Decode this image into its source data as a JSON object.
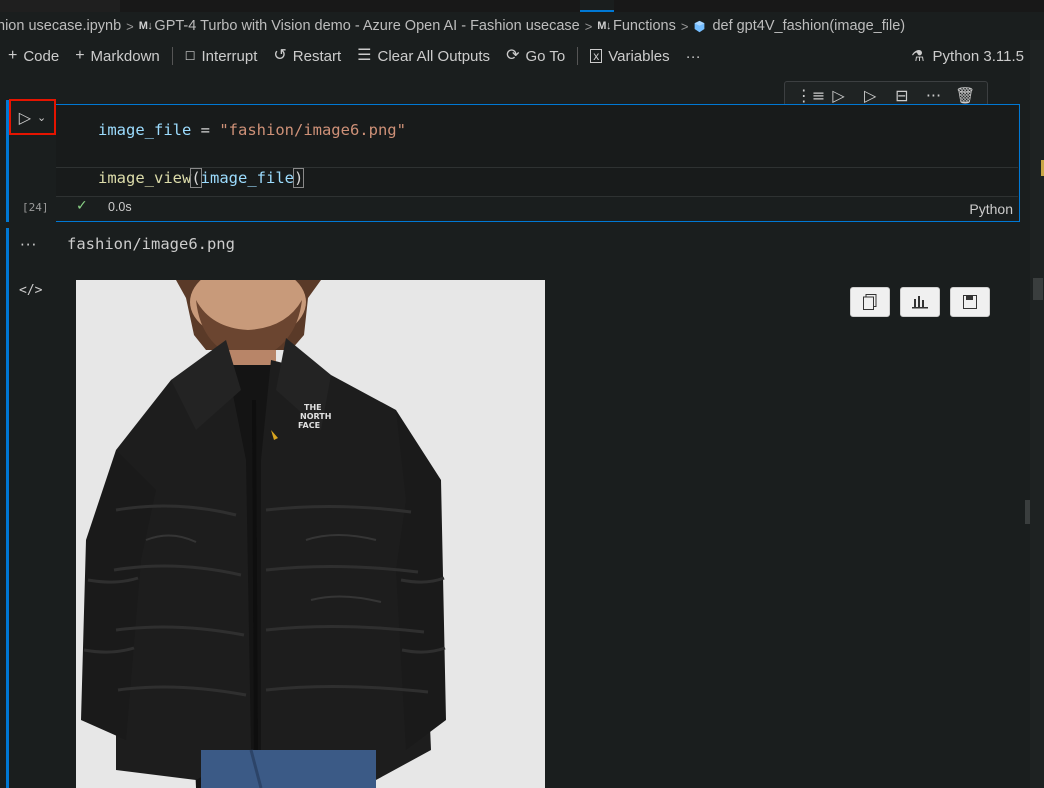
{
  "breadcrumb": {
    "items": [
      {
        "label": "hion usecase.ipynb",
        "badge": ""
      },
      {
        "label": "GPT-4 Turbo with Vision demo - Azure Open AI - Fashion usecase",
        "badge": "M↓"
      },
      {
        "label": "Functions",
        "badge": "M↓"
      },
      {
        "label": "def gpt4V_fashion(image_file)",
        "badge": ""
      }
    ]
  },
  "toolbar": {
    "code_label": "Code",
    "markdown_label": "Markdown",
    "interrupt_label": "Interrupt",
    "restart_label": "Restart",
    "clear_label": "Clear All Outputs",
    "goto_label": "Go To",
    "variables_label": "Variables",
    "more_label": "···",
    "kernel_label": "Python 3.11.5"
  },
  "cell": {
    "line1": {
      "var": "image_file",
      "op": " = ",
      "str": "\"fashion/image6.png\""
    },
    "line2": {
      "fn": "image_view",
      "open": "(",
      "arg": "image_file",
      "close": ")"
    },
    "exec_count": "[24]",
    "status_check": "✓",
    "exec_time": "0.0s",
    "language": "Python"
  },
  "output": {
    "text": "fashion/image6.png",
    "brand_text": [
      "THE",
      "NORTH",
      "FACE"
    ]
  },
  "colors": {
    "accent": "#0078d4",
    "run_highlight": "#e51400",
    "string": "#ce9178",
    "variable": "#9cdcfe",
    "function": "#dcdcaa"
  }
}
